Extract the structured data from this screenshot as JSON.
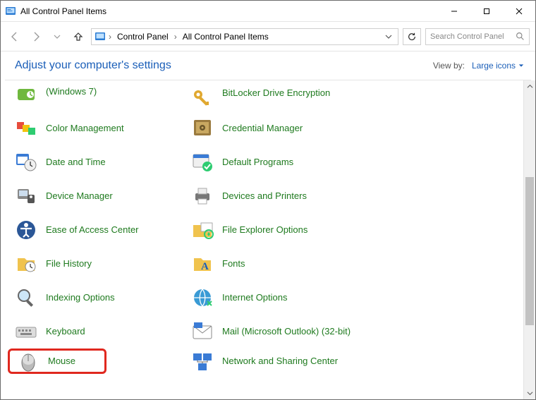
{
  "window": {
    "title": "All Control Panel Items"
  },
  "breadcrumb": {
    "parts": [
      "Control Panel",
      "All Control Panel Items"
    ]
  },
  "search": {
    "placeholder": "Search Control Panel"
  },
  "subheader": {
    "adjust": "Adjust your computer's settings",
    "viewby_label": "View by:",
    "viewby_value": "Large icons"
  },
  "items": {
    "r0c0": "(Windows 7)",
    "r0c1": "BitLocker Drive Encryption",
    "r1c0": "Color Management",
    "r1c1": "Credential Manager",
    "r2c0": "Date and Time",
    "r2c1": "Default Programs",
    "r3c0": "Device Manager",
    "r3c1": "Devices and Printers",
    "r4c0": "Ease of Access Center",
    "r4c1": "File Explorer Options",
    "r5c0": "File History",
    "r5c1": "Fonts",
    "r6c0": "Indexing Options",
    "r6c1": "Internet Options",
    "r7c0": "Keyboard",
    "r7c1": "Mail (Microsoft Outlook) (32-bit)",
    "r8c0": "Mouse",
    "r8c1": "Network and Sharing Center"
  }
}
